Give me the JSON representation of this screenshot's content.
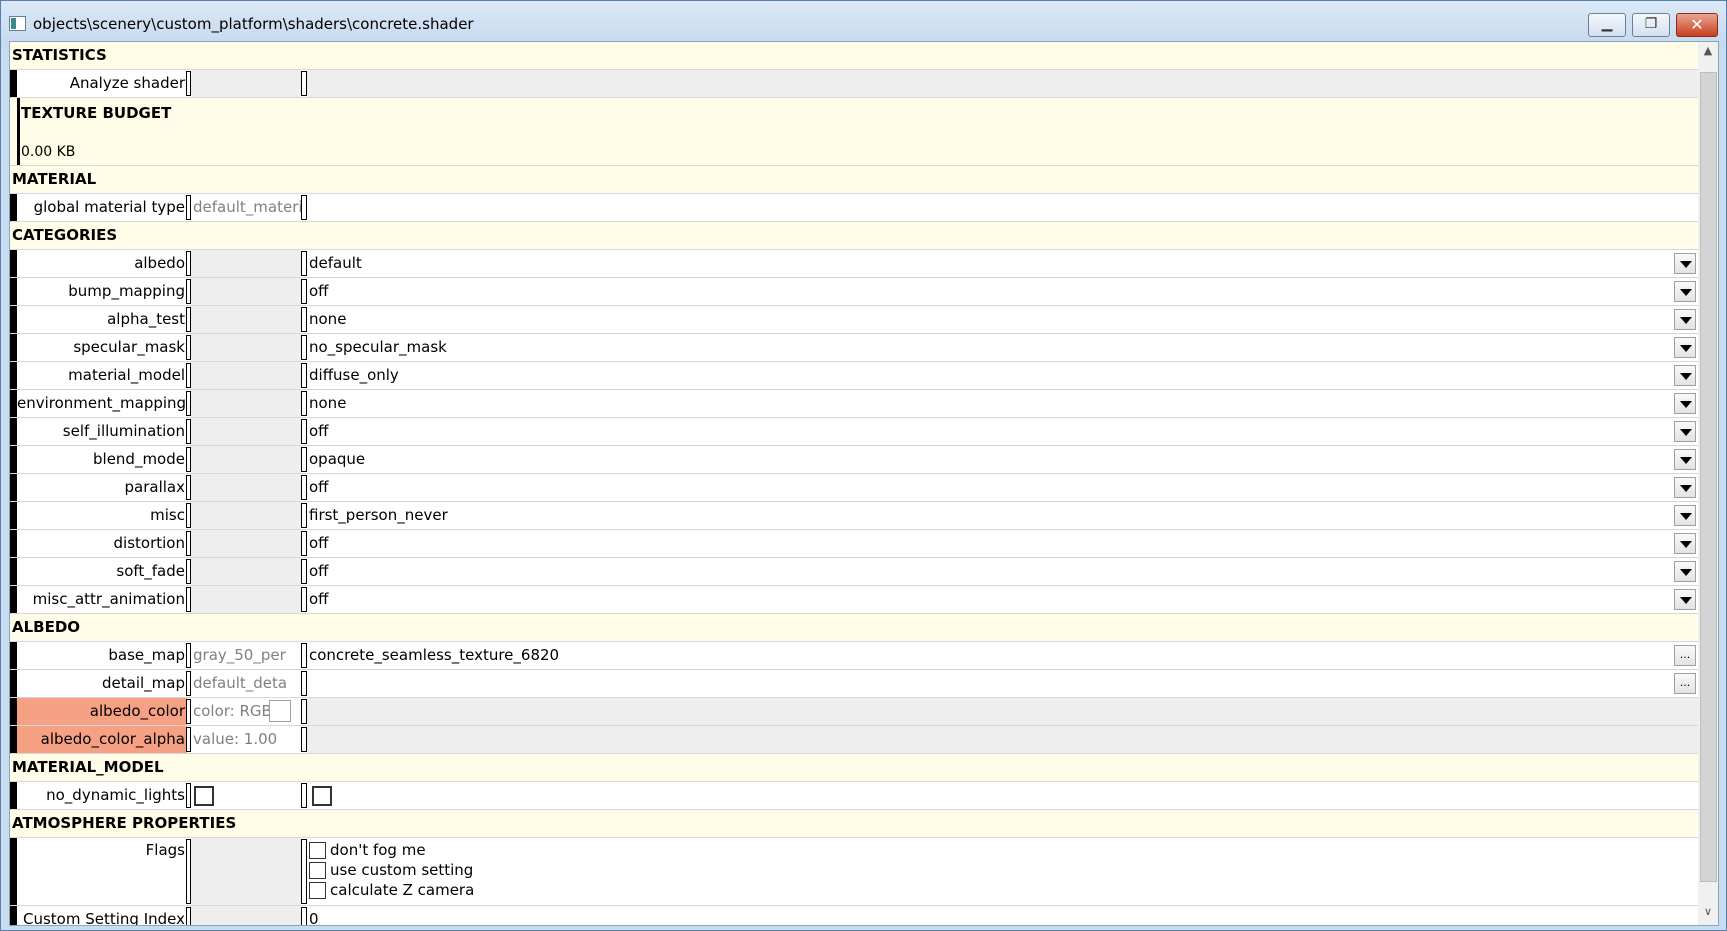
{
  "window": {
    "title": "objects\\scenery\\custom_platform\\shaders\\concrete.shader",
    "minimize_glyph": "▁",
    "maximize_glyph": "❐",
    "close_glyph": "✕"
  },
  "statistics": {
    "header": "STATISTICS",
    "analyze_label": "Analyze shader"
  },
  "texture_budget": {
    "header": "TEXTURE BUDGET",
    "value": "0.00 KB"
  },
  "material": {
    "header": "MATERIAL",
    "global_type_label": "global material type",
    "global_type_value": "default_materia"
  },
  "categories": {
    "header": "CATEGORIES",
    "items": [
      {
        "label": "albedo",
        "value": "default"
      },
      {
        "label": "bump_mapping",
        "value": "off"
      },
      {
        "label": "alpha_test",
        "value": "none"
      },
      {
        "label": "specular_mask",
        "value": "no_specular_mask"
      },
      {
        "label": "material_model",
        "value": "diffuse_only"
      },
      {
        "label": "environment_mapping",
        "value": "none"
      },
      {
        "label": "self_illumination",
        "value": "off"
      },
      {
        "label": "blend_mode",
        "value": "opaque"
      },
      {
        "label": "parallax",
        "value": "off"
      },
      {
        "label": "misc",
        "value": "first_person_never"
      },
      {
        "label": "distortion",
        "value": "off"
      },
      {
        "label": "soft_fade",
        "value": "off"
      },
      {
        "label": "misc_attr_animation",
        "value": "off"
      }
    ]
  },
  "albedo": {
    "header": "ALBEDO",
    "base_map_label": "base_map",
    "base_map_default": "gray_50_per",
    "base_map_value": "concrete_seamless_texture_6820",
    "detail_map_label": "detail_map",
    "detail_map_default": "default_deta",
    "color_label": "albedo_color",
    "color_value": "color: RGB",
    "alpha_label": "albedo_color_alpha",
    "alpha_value": "value: 1.00",
    "highlight_color": "#f7a184",
    "browse_glyph": "..."
  },
  "material_model": {
    "header": "MATERIAL_MODEL",
    "no_dynamic_lights_label": "no_dynamic_lights"
  },
  "atmosphere": {
    "header": "ATMOSPHERE PROPERTIES",
    "flags_label": "Flags",
    "flags": [
      "don't fog me",
      "use custom setting",
      "calculate Z camera"
    ],
    "custom_index_label": "Custom Setting Index",
    "custom_index_value": "0"
  },
  "scrollbar": {
    "up_glyph": "▲",
    "down_glyph": "∨"
  }
}
